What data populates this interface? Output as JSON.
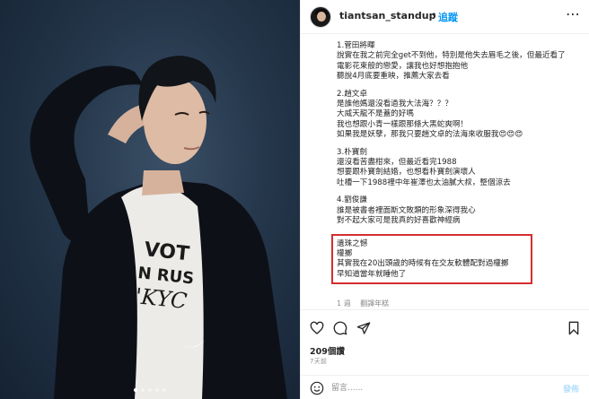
{
  "header": {
    "username": "tiantsan_standup",
    "separator": "•",
    "follow_label": "追蹤",
    "more_label": "⋯"
  },
  "photo": {
    "shirt_text": "VOT\nN RUS\n'KYC",
    "carousel_total": 5,
    "carousel_active": 0
  },
  "caption": {
    "blocks": [
      {
        "lines": [
          "1.菅田將暉",
          "說實在我之前完全get不到他，特別是他失去眉毛之後，但最近看了",
          "電影花束般的戀愛，讓我也好想抱抱他",
          "聽說4月底要重映，推薦大家去看"
        ]
      },
      {
        "lines": [
          "2.趙文卓",
          "是誰他媽還沒看過我大法海？？？",
          "大威天龍不是蓋的好嗎",
          "我也想跟小青一樣跟那條大黑蛇爽啊！",
          "如果我是妖孽，那我只要趙文卓的法海來收服我😍😍😍"
        ]
      },
      {
        "lines": [
          "3.朴寶劍",
          "還沒看苦盡柑來，但最近看完1988",
          "想要跟朴寶劍結婚，也想看朴寶劍演壞人",
          "吐槽一下1988裡中年崔澤也太油膩大叔，整個涼去"
        ]
      },
      {
        "lines": [
          "4.劉俊謙",
          "誰是被書者裡面斯文敗類的形象深得我心",
          "對不起大家可是我真的好喜歡神經病"
        ]
      }
    ],
    "highlight_lines": [
      "遺珠之憾",
      "權擲",
      "其實我在20出頭歲的時候有在交友軟體配對過權擲",
      "早知道當年就睡他了"
    ],
    "meta_week": "1 週",
    "meta_translate": "翻譯年糕"
  },
  "stats": {
    "likes": "209個讚",
    "time": "7天前"
  },
  "comment": {
    "placeholder": "留言......",
    "post_label": "發佈"
  },
  "colors": {
    "accent": "#0095f6",
    "highlight_border": "#d32f2f",
    "background_photo": "#24364a"
  },
  "icons": [
    "heart-icon",
    "comment-icon",
    "share-icon",
    "bookmark-icon",
    "emoji-icon",
    "more-icon",
    "nike-swoosh-icon"
  ]
}
